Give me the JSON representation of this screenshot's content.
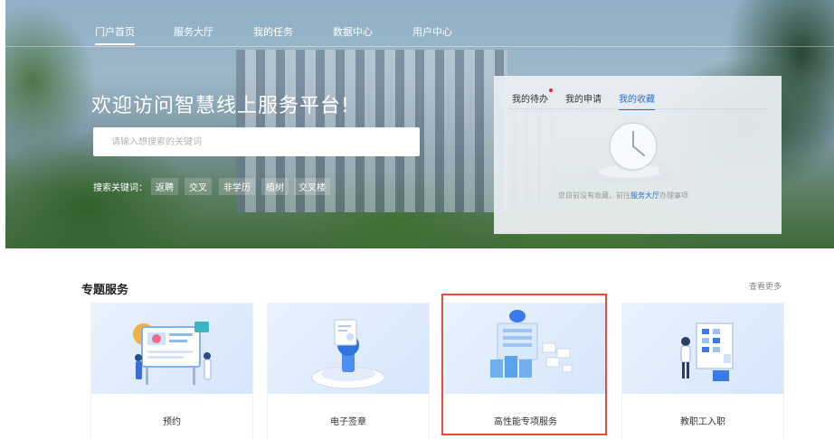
{
  "nav": {
    "items": [
      {
        "label": "门户首页",
        "active": true
      },
      {
        "label": "服务大厅",
        "active": false
      },
      {
        "label": "我的任务",
        "active": false
      },
      {
        "label": "数据中心",
        "active": false
      },
      {
        "label": "用户中心",
        "active": false
      }
    ]
  },
  "hero": {
    "welcome": "欢迎访问智慧线上服务平台!",
    "search_placeholder": "请输入想搜索的关键词",
    "keyword_label": "搜索关键词：",
    "keywords": [
      "返聘",
      "交叉",
      "非学历",
      "植树",
      "交叉楼"
    ]
  },
  "panel": {
    "tabs": [
      {
        "label": "我的待办",
        "active": false,
        "badge": true
      },
      {
        "label": "我的申请",
        "active": false,
        "badge": false
      },
      {
        "label": "我的收藏",
        "active": true,
        "badge": false
      }
    ],
    "empty_prefix": "您目前没有收藏，前往",
    "empty_link": "服务大厅",
    "empty_suffix": "办理事项",
    "empty_icon": "clock-icon"
  },
  "section": {
    "title": "专题服务",
    "more": "查看更多"
  },
  "cards": [
    {
      "label": "预约",
      "icon": "appointment-illustration"
    },
    {
      "label": "电子签章",
      "icon": "e-seal-illustration"
    },
    {
      "label": "高性能专项服务",
      "icon": "hpc-server-illustration"
    },
    {
      "label": "教职工入职",
      "icon": "onboarding-illustration"
    }
  ],
  "colors": {
    "accent": "#2a6ed1",
    "highlight": "#e84a3c"
  }
}
